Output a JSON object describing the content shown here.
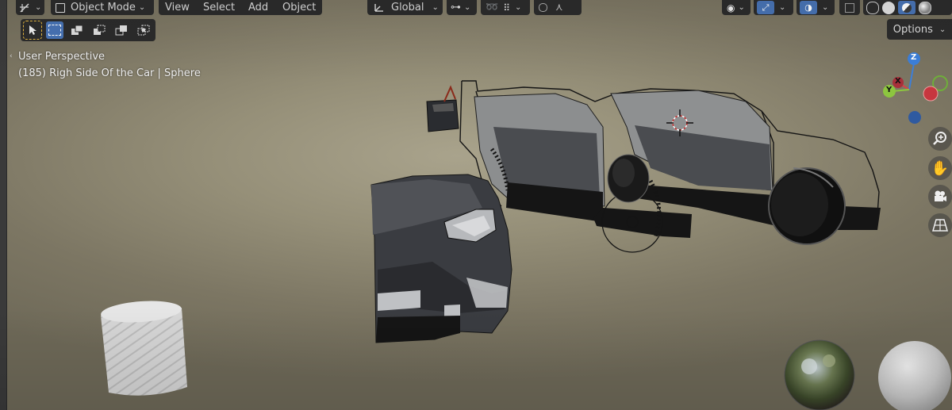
{
  "header": {
    "mode_label": "Object Mode",
    "menu": [
      "View",
      "Select",
      "Add",
      "Object"
    ],
    "transform_orientation": "Global"
  },
  "toolbar": {
    "tools": [
      "cursor-select-icon",
      "select-box-icon",
      "select-extend-icon",
      "select-subtract-icon",
      "select-invert-icon",
      "select-intersect-icon"
    ]
  },
  "options_label": "Options",
  "viewport": {
    "perspective_label": "User Perspective",
    "object_info": "(185) Righ Side Of the Car | Sphere"
  },
  "gizmo": {
    "z": "Z",
    "x": "X",
    "y": "Y"
  },
  "colors": {
    "header_bg": "#2b2b2b",
    "viewport_bg": "#958f78",
    "axis_x": "#d8404a",
    "axis_y": "#8dc63f",
    "axis_z": "#3c7fd9",
    "active_tool_outline": "#e6b73f"
  }
}
